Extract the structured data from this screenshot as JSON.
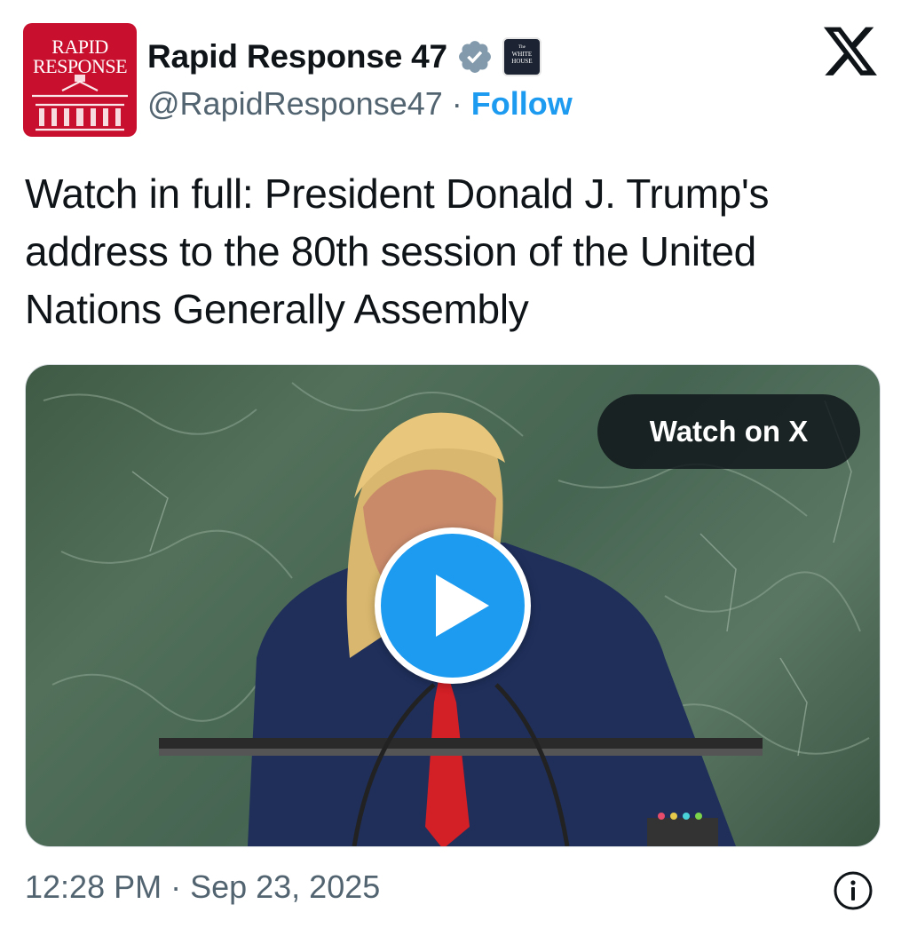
{
  "header": {
    "avatar_text": [
      "RAPID",
      "RESPONSE"
    ],
    "display_name": "Rapid Response 47",
    "affiliation_badge_text": [
      "The",
      "WHITE",
      "HOUSE"
    ],
    "handle": "@RapidResponse47",
    "separator": "·",
    "follow_label": "Follow",
    "verified_icon": "verified-badge-icon",
    "close_icon": "x-logo-icon"
  },
  "tweet": {
    "text": "Watch in full: President Donald J. Trump's address to the 80th session of the United Nations Generally Assembly"
  },
  "media": {
    "watch_label": "Watch on X",
    "play_icon": "play-icon"
  },
  "footer": {
    "timestamp": "12:28 PM · Sep 23, 2025",
    "info_icon": "info-icon"
  },
  "colors": {
    "accent": "#1d9bf0",
    "text_primary": "#0f1419",
    "text_secondary": "#536471",
    "avatar_red": "#c8102e",
    "verified_gray": "#829aab"
  }
}
